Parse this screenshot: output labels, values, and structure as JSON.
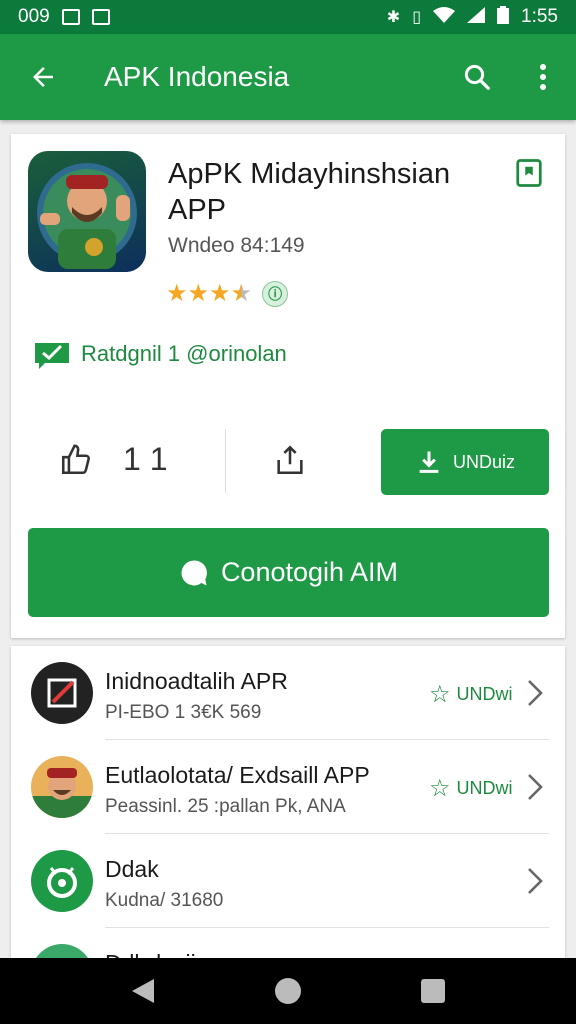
{
  "status_bar": {
    "left_text": "009",
    "time": "1:55"
  },
  "app_bar": {
    "title": "APK Indonesia"
  },
  "app": {
    "title": "ApPK Midayhinshsian APP",
    "subtitle": "Wndeo 84:149",
    "rating_stars": 3.5,
    "verified_text": "Ratdgnil 1 @orinolan",
    "stat_count": "1 1",
    "download_label": "UNDuiz",
    "main_button_label": "Conotogih AIM"
  },
  "list_items": [
    {
      "title": "Inidnoadtalih APR",
      "subtitle": "PI-EBO 1 3€K 569",
      "action": "UNDwi",
      "icon": "pencil-icon"
    },
    {
      "title": "Eutlaolotata/ Exdsaill APP",
      "subtitle": "Peassinl. 25 :pallan Pk, ANA",
      "action": "UNDwi",
      "icon": "character-avatar"
    },
    {
      "title": "Ddak",
      "subtitle": "Kudna/ 31680",
      "action": "",
      "icon": "android-icon"
    },
    {
      "title": "Ddlwlasiia",
      "subtitle": "",
      "action": "",
      "icon": "app-icon"
    }
  ],
  "colors": {
    "primary": "#1e9945",
    "status_bar": "#0b7a3a",
    "star": "#f5a623"
  }
}
